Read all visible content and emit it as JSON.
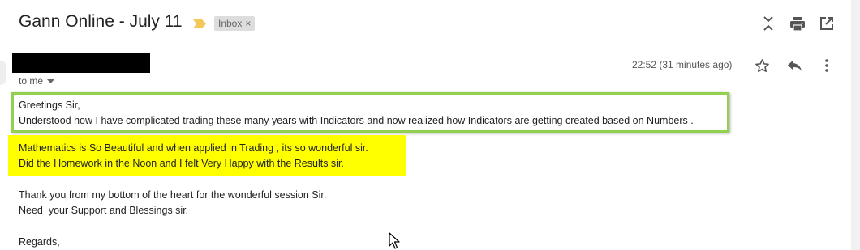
{
  "email": {
    "subject": "Gann Online - July 11",
    "label_chip": "Inbox",
    "label_chip_close": "×",
    "recipient_text": "to me",
    "timestamp": "22:52 (31 minutes ago)",
    "body": {
      "greeting": "Greetings Sir,",
      "line1": "Understood how I have complicated trading these many years with Indicators and now realized how Indicators are getting created based on Numbers .",
      "line2": "Mathematics is So Beautiful and when applied in Trading , its so wonderful sir.",
      "line3": "Did the Homework in the Noon and I felt Very Happy with the Results sir.",
      "line4": "Thank you from my bottom of the heart for the wonderful session Sir.",
      "line5": "Need  your Support and Blessings sir.",
      "closing": "Regards,"
    }
  },
  "icons": {
    "header": [
      "expand-collapse-icon",
      "print-icon",
      "open-in-new-window-icon"
    ],
    "actions": [
      "star-icon",
      "reply-icon",
      "more-vert-icon"
    ],
    "important": "important-marker-icon",
    "dropdown": "chevron-down-icon"
  },
  "colors": {
    "green_highlight_border": "#92d050",
    "yellow_highlight": "#ffff00",
    "important_marker": "#f2c85b",
    "chip_bg": "#dddddd"
  }
}
